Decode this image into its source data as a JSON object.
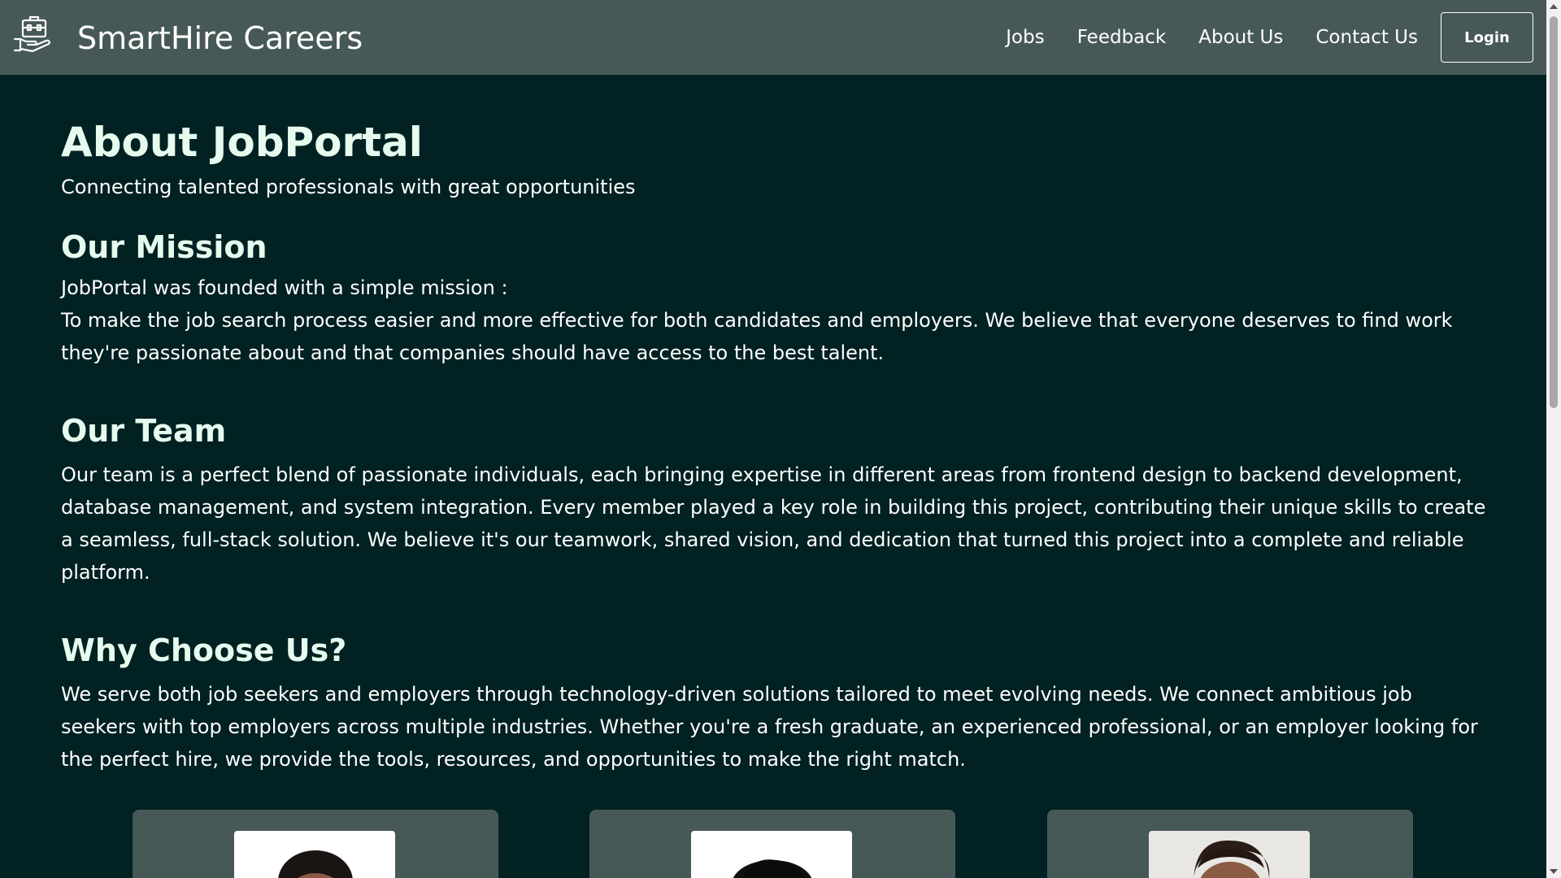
{
  "header": {
    "brand": "SmartHire Careers",
    "logo_icon": "briefcase-hand-icon",
    "nav": [
      "Jobs",
      "Feedback",
      "About Us",
      "Contact Us"
    ],
    "login_label": "Login"
  },
  "main": {
    "title": "About JobPortal",
    "subtitle": "Connecting talented professionals with great opportunities",
    "mission": {
      "heading": "Our Mission",
      "intro": "JobPortal was founded with a simple mission :",
      "body": "To make the job search process easier and more effective for both candidates and employers. We believe that everyone deserves to find work they're passionate about and that companies should have access to the best talent."
    },
    "team": {
      "heading": "Our Team",
      "body": "Our team is a perfect blend of passionate individuals, each bringing expertise in different areas from frontend design to backend development, database management, and system integration. Every member played a key role in building this project, contributing their unique skills to create a seamless, full-stack solution. We believe it's our teamwork, shared vision, and dedication that turned this project into a complete and reliable platform."
    },
    "why": {
      "heading": "Why Choose Us?",
      "body": "We serve both job seekers and employers through technology-driven solutions tailored to meet evolving needs. We connect ambitious job seekers with top employers across multiple industries. Whether you're a fresh graduate, an experienced professional, or an employer looking for the perfect hire, we provide the tools, resources, and opportunities to make the right match."
    }
  },
  "colors": {
    "background": "#012122",
    "navbar": "#475957",
    "heading": "#e6fbee",
    "card": "#475957"
  }
}
